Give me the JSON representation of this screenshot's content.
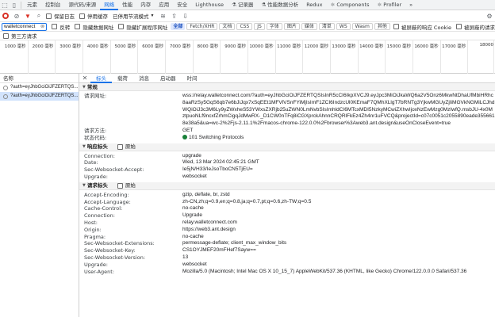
{
  "tabbar": {
    "tabs": [
      {
        "label": "元素",
        "icon": ""
      },
      {
        "label": "控制台",
        "icon": ""
      },
      {
        "label": "源代码/来源",
        "icon": ""
      },
      {
        "label": "网络",
        "icon": ""
      },
      {
        "label": "性能",
        "icon": ""
      },
      {
        "label": "内存",
        "icon": ""
      },
      {
        "label": "应用",
        "icon": ""
      },
      {
        "label": "安全",
        "icon": ""
      },
      {
        "label": "Lighthouse",
        "icon": ""
      },
      {
        "label": "记录器",
        "icon": "⚗"
      },
      {
        "label": "性能数据分析",
        "icon": "⚗"
      },
      {
        "label": "Redux",
        "icon": ""
      },
      {
        "label": "Components",
        "icon": "⚛"
      },
      {
        "label": "Profiler",
        "icon": "⚛"
      }
    ],
    "active_index": 3,
    "more": "»"
  },
  "toolbar1": {
    "preserve_log": "保留日志",
    "disable_cache": "停用缓存",
    "throttle": "已停用节流模式"
  },
  "toolbar2": {
    "filter_value": "walletconnect",
    "invert": "反转",
    "hide_data_urls": "隐藏数据网址",
    "hide_ext_urls": "隐藏扩展程序网址",
    "chips": [
      "全部",
      "Fetch/XHR",
      "文档",
      "CSS",
      "JS",
      "字体",
      "图片",
      "媒体",
      "清单",
      "WS",
      "Wasm",
      "其他"
    ],
    "active_chip": 0,
    "blocked_cookies": "被屏蔽的响应 Cookie",
    "blocked_requests": "被屏蔽的请求"
  },
  "toolbar3": {
    "third_party": "第三方请求"
  },
  "timeline": {
    "ticks": [
      "1000 毫秒",
      "2000 毫秒",
      "3000 毫秒",
      "4000 毫秒",
      "5000 毫秒",
      "6000 毫秒",
      "7000 毫秒",
      "8000 毫秒",
      "9000 毫秒",
      "10000 毫秒",
      "11000 毫秒",
      "12000 毫秒",
      "13000 毫秒",
      "14000 毫秒",
      "15000 毫秒",
      "16000 毫秒",
      "17000 毫秒",
      "18000"
    ]
  },
  "list": {
    "header": "名称",
    "items": [
      "?auth=eyJhbGciOiJFZERTQS...",
      "?auth=eyJhbGciOiJFZERTQS..."
    ],
    "selected_index": 1
  },
  "detail": {
    "tabs": [
      "标头",
      "载荷",
      "消息",
      "启动器",
      "时间"
    ],
    "active_tab": 0,
    "general": {
      "title": "常规",
      "rows": [
        {
          "k": "请求网址:",
          "v": "wss://relay.walletconnect.com/?auth=eyJhbGciOiJFZERTQSIsInR5cCI6IkpXVCJ9.eyJpc3MiOiJkaWQ6a2V5Onz6MkwNtDhaUfMbiHRhc8aaRzSy5GqS6qb7e6bJiJqx7xSqEEt1MFVlVSnFYiMjIsImF1ZCI6IndzcUl0KEmaF7QMhXLlgT7bRNTg3YjkwMGUyZjIiMGVkNGMiLCJhdWQiOiJ3c3M6Ly9yZWxheS53YWxsZXRjb25uZWN0LmNvbSIsImhldCI6MTcxMDI5NzkyMCwiZXhwIjoxNzEwMzg0MzIwfQ.msbJU-4x0MztpuoNLf9ncxfZrhmCigqJdMwRX-_D1CW0nTFq8iCGXprckAhnnCRQRlFkEz4Zh4nr1uFVCQ&projectId=c07c0051c2055890eade3556618e38a5&ua=wc-2%2Fjs-2.11.1%2Fmacos-chrome-122.0.0%2Fbrowser%3Aweb3.ant.design&useOnCloseEvent=true"
        },
        {
          "k": "请求方法:",
          "v": "GET"
        },
        {
          "k": "状态代码:",
          "v": "101 Switching Protocols",
          "status": true
        }
      ]
    },
    "response_headers": {
      "title": "响应标头",
      "raw": "原始",
      "rows": [
        {
          "k": "Connection:",
          "v": "upgrade"
        },
        {
          "k": "Date:",
          "v": "Wed, 13 Mar 2024 02:45:21 GMT"
        },
        {
          "k": "Sec-Websocket-Accept:",
          "v": "Ie5jN/H33/IeJsoTboCN5TjEU="
        },
        {
          "k": "Upgrade:",
          "v": "websocket"
        }
      ]
    },
    "request_headers": {
      "title": "请求标头",
      "raw": "原始",
      "rows": [
        {
          "k": "Accept-Encoding:",
          "v": "gzip, deflate, br, zstd"
        },
        {
          "k": "Accept-Language:",
          "v": "zh-CN,zh;q=0.9,en;q=0.8,ja;q=0.7,pt;q=0.6,zh-TW;q=0.5"
        },
        {
          "k": "Cache-Control:",
          "v": "no-cache"
        },
        {
          "k": "Connection:",
          "v": "Upgrade"
        },
        {
          "k": "Host:",
          "v": "relay.walletconnect.com"
        },
        {
          "k": "Origin:",
          "v": "https://web3.ant.design"
        },
        {
          "k": "Pragma:",
          "v": "no-cache"
        },
        {
          "k": "Sec-Websocket-Extensions:",
          "v": "permessage-deflate; client_max_window_bits"
        },
        {
          "k": "Sec-Websocket-Key:",
          "v": "CS1OYJMEF20mFHef7Sayw=="
        },
        {
          "k": "Sec-Websocket-Version:",
          "v": "13"
        },
        {
          "k": "Upgrade:",
          "v": "websocket"
        },
        {
          "k": "User-Agent:",
          "v": "Mozilla/5.0 (Macintosh; Intel Mac OS X 10_15_7) AppleWebKit/537.36 (KHTML, like Gecko) Chrome/122.0.0.0 Safari/537.36"
        }
      ]
    }
  },
  "colors": {
    "accent": "#1a73e8",
    "record": "#d93025",
    "status_ok": "#188038",
    "selected_row": "#d2e3fc"
  }
}
